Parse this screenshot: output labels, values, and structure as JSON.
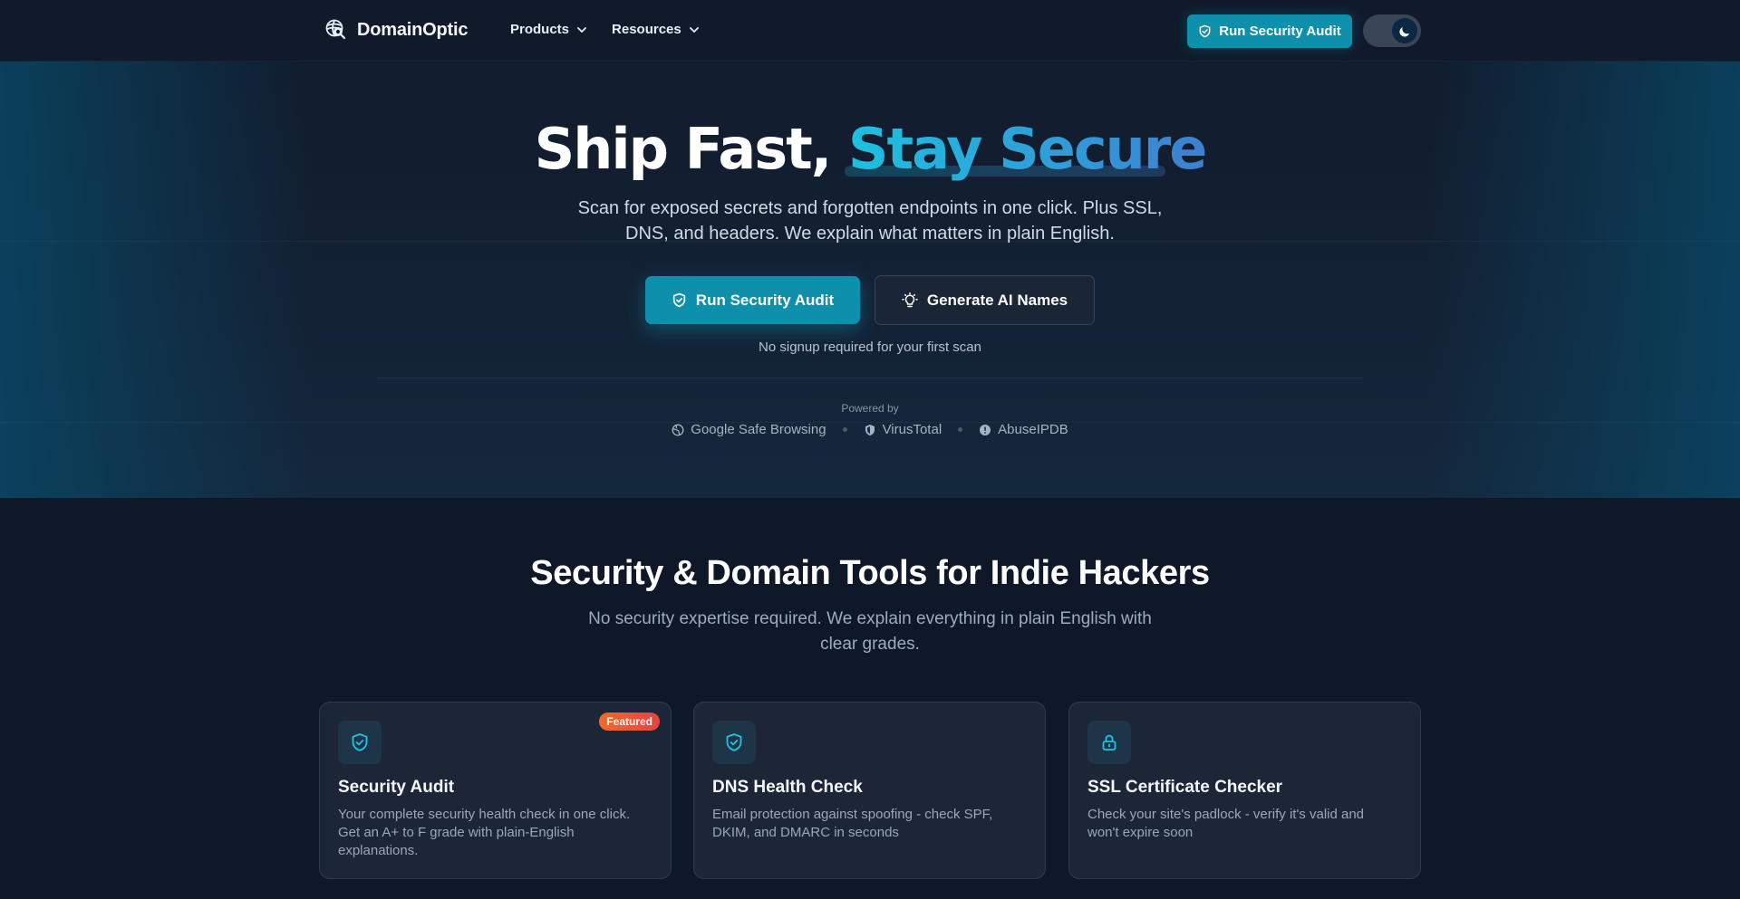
{
  "nav": {
    "brand": "DomainOptic",
    "menu": [
      {
        "label": "Products"
      },
      {
        "label": "Resources"
      }
    ],
    "cta_label": "Run Security Audit"
  },
  "hero": {
    "title_plain": "Ship Fast, ",
    "title_accent": "Stay Secure",
    "subtitle": "Scan for exposed secrets and forgotten endpoints in one click. Plus SSL, DNS, and headers. We explain what matters in plain English.",
    "primary_button": "Run Security Audit",
    "secondary_button": "Generate AI Names",
    "note": "No signup required for your first scan",
    "powered_by_label": "Powered by",
    "providers": [
      {
        "name": "Google Safe Browsing",
        "icon": "globe-icon"
      },
      {
        "name": "VirusTotal",
        "icon": "shield-icon"
      },
      {
        "name": "AbuseIPDB",
        "icon": "alert-circle-icon"
      }
    ]
  },
  "tools": {
    "title": "Security & Domain Tools for Indie Hackers",
    "subtitle": "No security expertise required. We explain everything in plain English with clear grades.",
    "cards": [
      {
        "title": "Security Audit",
        "description": "Your complete security health check in one click. Get an A+ to F grade with plain-English explanations.",
        "badge": "Featured",
        "icon": "shield-check-icon"
      },
      {
        "title": "DNS Health Check",
        "description": "Email protection against spoofing - check SPF, DKIM, and DMARC in seconds",
        "icon": "shield-check-icon"
      },
      {
        "title": "SSL Certificate Checker",
        "description": "Check your site's padlock - verify it's valid and won't expire soon",
        "icon": "lock-icon"
      }
    ]
  },
  "colors": {
    "accent": "#0e8fac",
    "background": "#0f1829",
    "card": "#1c2637",
    "badge": "#e85a34"
  }
}
